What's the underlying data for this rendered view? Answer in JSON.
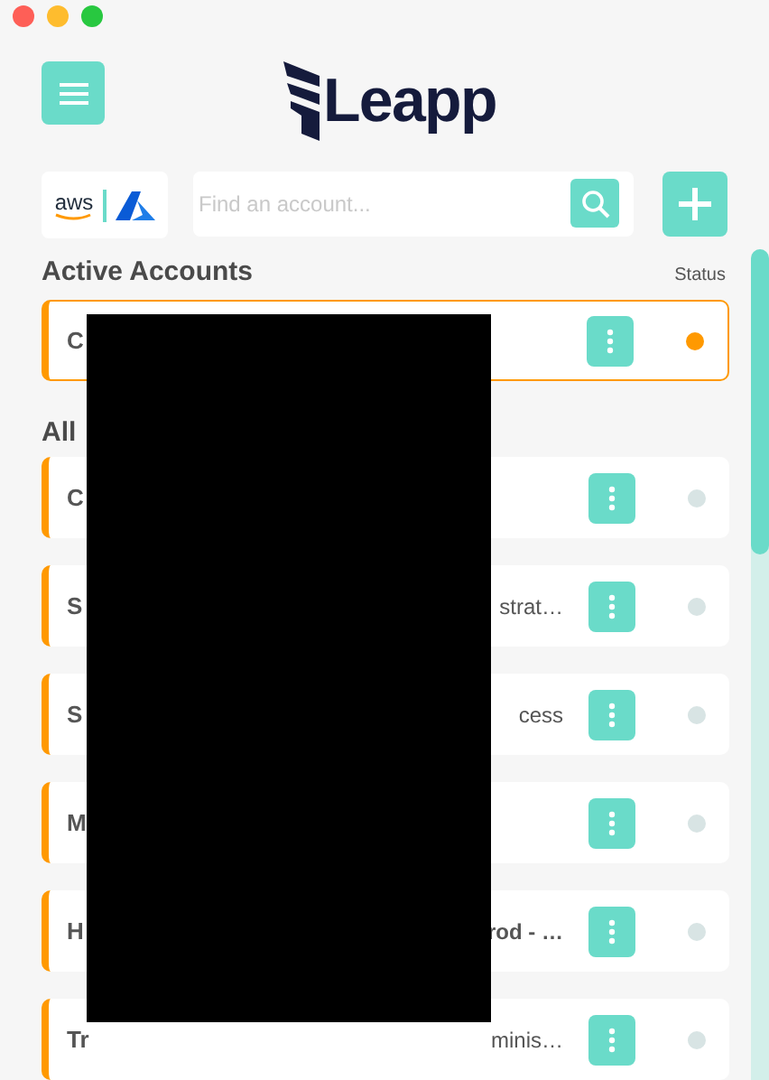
{
  "logo": {
    "text": "Leapp"
  },
  "providers": {
    "aws": "aws"
  },
  "search": {
    "placeholder": "Find an account..."
  },
  "active_heading": "Active Accounts",
  "status_heading": "Status",
  "active_accounts": [
    {
      "name": "C",
      "active": true
    }
  ],
  "all_heading": "All",
  "accounts": [
    {
      "name": "C",
      "active": false
    },
    {
      "name": "S",
      "detail": "strat…",
      "active": false
    },
    {
      "name": "S",
      "detail": "cess",
      "active": false
    },
    {
      "name": "M",
      "active": false
    },
    {
      "name": "H",
      "name_tail": "rod - …",
      "active": false
    },
    {
      "name": "Tr",
      "detail": "minis…",
      "active": false
    }
  ]
}
